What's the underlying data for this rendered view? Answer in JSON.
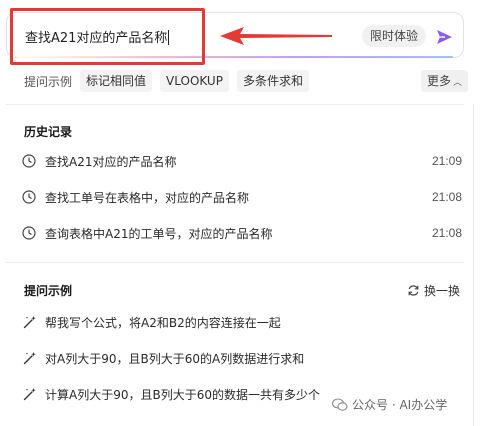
{
  "search": {
    "value": "查找A21对应的产品名称",
    "mode_chip": "限时体验"
  },
  "suggestions": {
    "label": "提问示例",
    "chips": [
      "标记相同值",
      "VLOOKUP",
      "多条件求和"
    ],
    "more_label": "更多"
  },
  "history": {
    "title": "历史记录",
    "items": [
      {
        "text": "查找A21对应的产品名称",
        "time": "21:09"
      },
      {
        "text": "查找工单号在表格中，对应的产品名称",
        "time": "21:08"
      },
      {
        "text": "查询表格中A21的工单号，对应的产品名称",
        "time": "21:08"
      }
    ]
  },
  "examples": {
    "title": "提问示例",
    "refresh_label": "换一换",
    "items": [
      "帮我写个公式，将A2和B2的内容连接在一起",
      "对A列大于90，且B列大于60的A列数据进行求和",
      "计算A列大于90，且B列大于60的数据一共有多少个"
    ]
  },
  "watermark": {
    "text": "公众号 · AI办公学"
  },
  "colors": {
    "annotation_red": "#e53935",
    "send_purple": "#8b5cf6",
    "chip_bg": "#f3f3f3"
  },
  "icons": {
    "send": "send-arrow-icon",
    "clock": "clock-icon",
    "refresh": "refresh-icon",
    "wand": "magic-wand-icon",
    "annotation": "red-arrow-annotation"
  }
}
